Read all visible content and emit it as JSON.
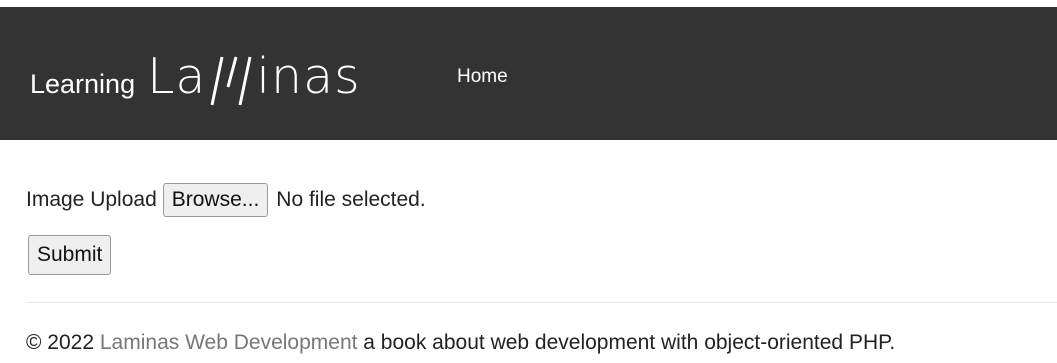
{
  "navbar": {
    "brand_prefix": "Learning",
    "brand_logo_left": "La",
    "brand_logo_right": "inas",
    "home_label": "Home",
    "background_color": "#333333"
  },
  "form": {
    "upload_label": "Image Upload",
    "browse_label": "Browse...",
    "file_status": "No file selected.",
    "submit_label": "Submit"
  },
  "footer": {
    "copyright": "© 2022",
    "link_text": "Laminas Web Development",
    "description": "a book about web development with object-oriented PHP.",
    "link_color": "#777777"
  }
}
